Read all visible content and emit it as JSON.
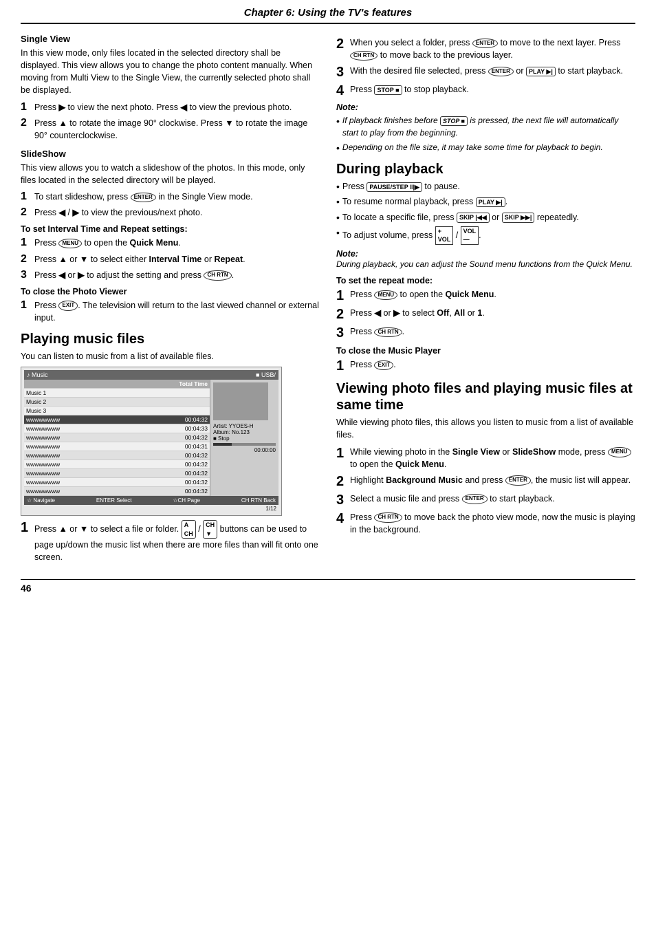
{
  "header": {
    "title": "Chapter 6: Using the TV's features"
  },
  "left_column": {
    "single_view": {
      "title": "Single View",
      "body": "In this view mode, only files located in the selected directory shall be displayed. This view allows you to change the photo content manually. When moving from Multi View to the Single View, the currently selected photo shall be displayed.",
      "steps": [
        {
          "num": "1",
          "text": "Press ▶ to view the next photo. Press ◀ to view the previous photo."
        },
        {
          "num": "2",
          "text": "Press ▲ to rotate the image 90° clockwise. Press ▼ to rotate the image 90° counterclockwise."
        }
      ]
    },
    "slideshow": {
      "title": "SlideShow",
      "body": "This view allows you to watch a slideshow of the photos. In this mode, only files located in the selected directory will be played.",
      "steps": [
        {
          "num": "1",
          "text": "To start slideshow, press ENTER in the Single View mode."
        },
        {
          "num": "2",
          "text": "Press ◀ / ▶ to view the previous/next photo."
        }
      ]
    },
    "interval_time": {
      "title": "To set Interval Time and Repeat settings:",
      "steps": [
        {
          "num": "1",
          "text": "Press MENU to open the Quick Menu."
        },
        {
          "num": "2",
          "text": "Press ▲ or ▼ to select either Interval Time or Repeat."
        },
        {
          "num": "3",
          "text": "Press ◀ or ▶ to adjust the setting and press CH RTN."
        }
      ]
    },
    "close_photo": {
      "title": "To close the Photo Viewer",
      "steps": [
        {
          "num": "1",
          "text": "Press EXIT. The television will return to the last viewed channel or external input."
        }
      ]
    },
    "playing_music": {
      "title": "Playing music files",
      "body": "You can listen to music from a list of available files.",
      "music_screen": {
        "header_left": "♪ Music",
        "path": "■ USB/",
        "col_title": "Total Time",
        "page_indicator": "1/12",
        "rows": [
          {
            "name": "Music 1",
            "time": ""
          },
          {
            "name": "Music 2",
            "time": ""
          },
          {
            "name": "Music 3",
            "time": ""
          },
          {
            "name": "wwwwwwww",
            "time": "00:04:32"
          },
          {
            "name": "wwwwwwww",
            "time": "00:04:33"
          },
          {
            "name": "wwwwwwww",
            "time": "00:04:32"
          },
          {
            "name": "wwwwwwww",
            "time": "00:04:31"
          },
          {
            "name": "wwwwwwww",
            "time": "00:04:32"
          },
          {
            "name": "wwwwwwww",
            "time": "00:04:32"
          },
          {
            "name": "wwwwwwww",
            "time": "00:04:32"
          },
          {
            "name": "wwwwwwww",
            "time": "00:04:32"
          },
          {
            "name": "wwwwwwww",
            "time": "00:04:32"
          }
        ],
        "info_panel": {
          "artist": "Artist: YYOES-H",
          "album": "Album: No.123",
          "stop_label": "■ Stop"
        },
        "progress_time": "00:00:00",
        "bottom_bar": {
          "navigate": "☆ Navigate",
          "enter_select": "ENTER Select",
          "page": "☆CH Page",
          "back": "CH RTN Back"
        }
      },
      "steps": [
        {
          "num": "1",
          "text": "Press ▲ or ▼ to select a file or folder.  [A/CH] / [CH/▼]  buttons can be used to page up/down the music list when there are more files than will fit onto one screen."
        }
      ]
    }
  },
  "right_column": {
    "steps_continued": [
      {
        "num": "2",
        "text": "When you select a folder, press ENTER to move to the next layer. Press CH RTN to move back to the previous layer."
      },
      {
        "num": "3",
        "text": "With the desired file selected, press ENTER or PLAY to start playback."
      },
      {
        "num": "4",
        "text": "Press STOP to stop playback."
      }
    ],
    "note1": {
      "label": "Note:",
      "bullets": [
        "If playback finishes before STOP is pressed, the next file will automatically start to play from the beginning.",
        "Depending on the file size, it may take some time for playback to begin."
      ]
    },
    "during_playback": {
      "title": "During playback",
      "bullets": [
        "Press PAUSE/STEP to pause.",
        "To resume normal playback, press PLAY.",
        "To locate a specific file, press SKIP or SKIP repeatedly.",
        "To adjust volume, press VOL+ / VOL-."
      ]
    },
    "note2": {
      "label": "Note:",
      "text": "During playback, you can adjust the Sound menu functions from the Quick Menu."
    },
    "repeat_mode": {
      "title": "To set the repeat mode:",
      "steps": [
        {
          "num": "1",
          "text": "Press MENU to open the Quick Menu."
        },
        {
          "num": "2",
          "text": "Press ◀ or ▶ to select Off, All or 1."
        },
        {
          "num": "3",
          "text": "Press CH RTN."
        }
      ]
    },
    "close_music": {
      "title": "To close the Music Player",
      "steps": [
        {
          "num": "1",
          "text": "Press EXIT."
        }
      ]
    },
    "viewing_photo_music": {
      "title": "Viewing photo files and playing music files at same time",
      "body": "While viewing photo files, this allows you listen to music from a list of available files.",
      "steps": [
        {
          "num": "1",
          "text": "While viewing photo in the Single View or SlideShow mode, press MENU to open the Quick Menu."
        },
        {
          "num": "2",
          "text": "Highlight Background Music and press ENTER, the music list will appear."
        },
        {
          "num": "3",
          "text": "Select a music file and press ENTER to start playback."
        },
        {
          "num": "4",
          "text": "Press CH RTN to move back the photo view mode, now the music is playing in the background."
        }
      ]
    }
  },
  "footer": {
    "page_number": "46"
  }
}
